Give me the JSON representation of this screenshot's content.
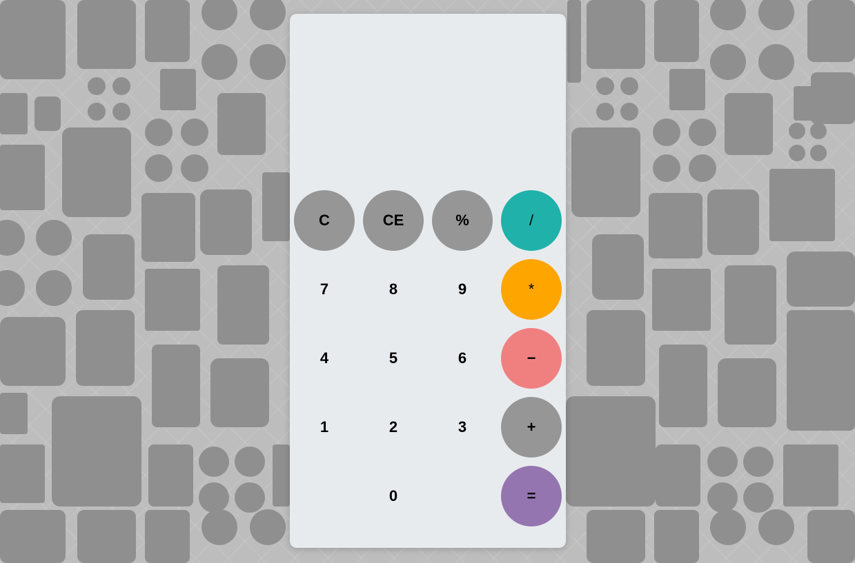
{
  "display": {
    "value": ""
  },
  "keys": {
    "clear": "C",
    "clear_entry": "CE",
    "percent": "%",
    "divide": "/",
    "seven": "7",
    "eight": "8",
    "nine": "9",
    "multiply": "*",
    "four": "4",
    "five": "5",
    "six": "6",
    "subtract": "−",
    "one": "1",
    "two": "2",
    "three": "3",
    "add": "+",
    "zero": "0",
    "equals": "="
  },
  "colors": {
    "panel": "#e8ebee",
    "function_keys": "#969696",
    "divide": "#20b2aa",
    "multiply": "#ffa500",
    "subtract": "#f08080",
    "add": "#969696",
    "equals": "#9575b0",
    "background": "#bdbdbd"
  }
}
